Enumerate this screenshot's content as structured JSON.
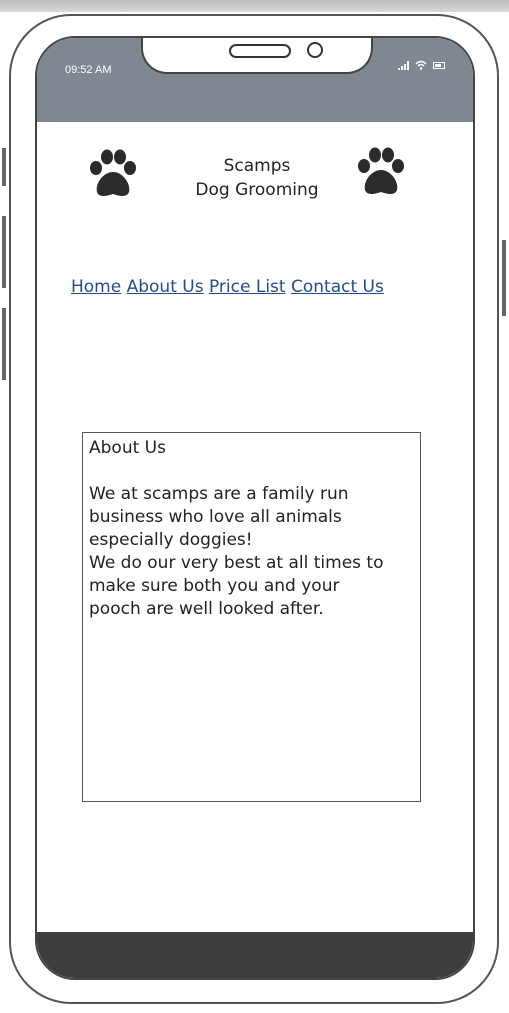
{
  "status_bar": {
    "time": "09:52 AM"
  },
  "header": {
    "brand_line1": "Scamps",
    "brand_line2": "Dog Grooming"
  },
  "nav": {
    "items": [
      "Home",
      "About Us",
      "Price List",
      "Contact Us"
    ]
  },
  "about": {
    "heading": "About Us",
    "paragraph1_line1": "We at scamps are a family run",
    "paragraph1_line2": "business who love all animals",
    "paragraph1_line3": "especially doggies!",
    "paragraph2_line1": "We do our very best at all times to",
    "paragraph2_line2": "make sure both you and your",
    "paragraph2_line3": "pooch are well looked after."
  },
  "icons": {
    "paw": "paw-print-icon",
    "signal": "signal-bars-icon",
    "wifi": "wifi-icon",
    "battery": "battery-icon"
  },
  "colors": {
    "status_bar": "#7f8790",
    "link": "#1f4e8c",
    "bottom_bar": "#3d3d3d"
  }
}
